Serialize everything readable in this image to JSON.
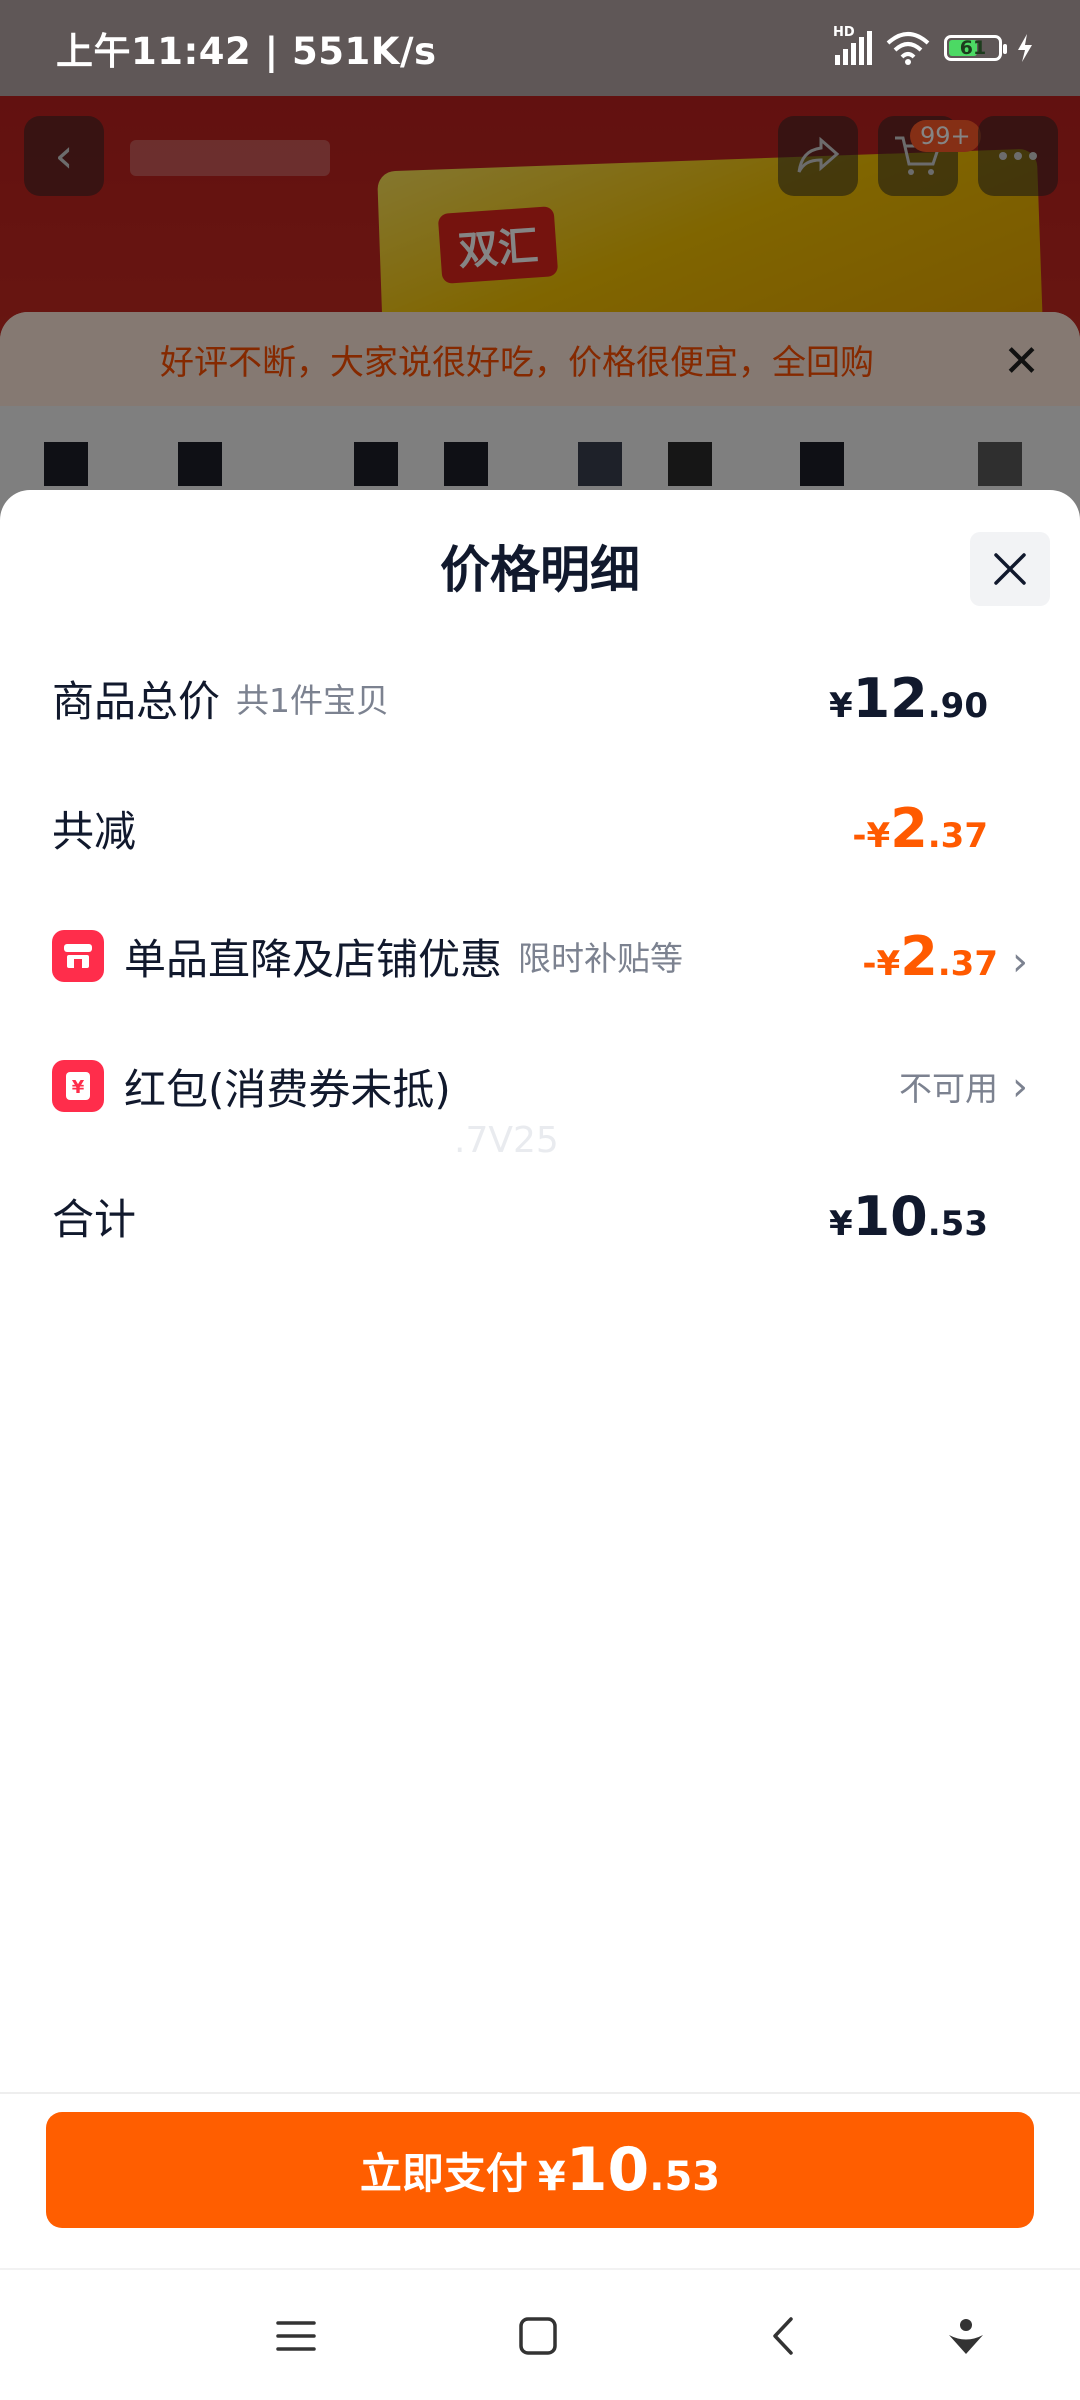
{
  "status_bar": {
    "time_speed": "上午11:42 | 551K/s",
    "network_label": "HD",
    "battery": "61",
    "battery_level": 0.61
  },
  "background_page": {
    "cart_badge": "99+",
    "notice": "好评不断，大家说很好吃，价格很便宜，全回购",
    "product_logo": "双汇"
  },
  "sheet": {
    "title": "价格明细",
    "rows": {
      "total": {
        "label": "商品总价",
        "sub": "共1件宝贝",
        "symbol": "¥",
        "int": "12",
        "dec": ".90"
      },
      "reduction": {
        "label": "共减",
        "symbol": "-¥",
        "int": "2",
        "dec": ".37"
      },
      "discount": {
        "label": "单品直降及店铺优惠",
        "sub": "限时补贴等",
        "symbol": "-¥",
        "int": "2",
        "dec": ".37"
      },
      "redpacket": {
        "label": "红包(消费券未抵)",
        "status": "不可用"
      },
      "sum": {
        "label": "合计",
        "symbol": "¥",
        "int": "10",
        "dec": ".53"
      }
    },
    "watermark": ".7V25"
  },
  "pay_button": {
    "label": "立即支付",
    "symbol": "¥",
    "int": "10",
    "dec": ".53"
  },
  "colors": {
    "accent": "#ff5e00",
    "discount_text": "#ff5a00",
    "tag_icon": "#ff2d4b",
    "title": "#11192d"
  }
}
